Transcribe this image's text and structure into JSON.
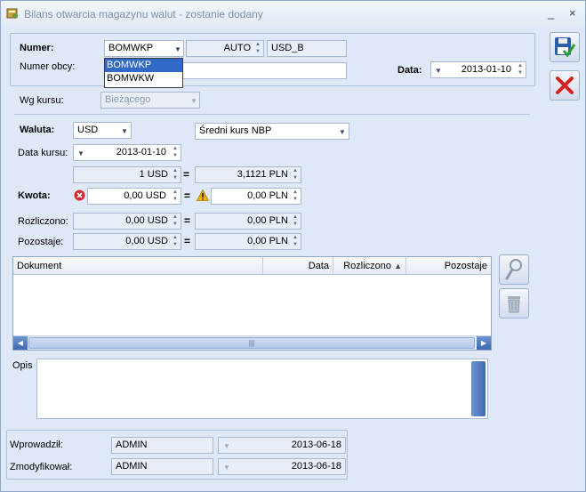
{
  "window": {
    "title": "Bilans otwarcia magazynu walut - zostanie dodany",
    "minimize_glyph": "_",
    "close_glyph": "×"
  },
  "header": {
    "numer_label": "Numer:",
    "numer_value": "BOMWKP",
    "numer_options": [
      "BOMWKP",
      "BOMWKW"
    ],
    "auto_value": "AUTO",
    "series_value": "USD_B",
    "numer_obcy_label": "Numer obcy:",
    "numer_obcy_value": "",
    "data_label": "Data:",
    "data_value": "2013-01-10"
  },
  "rate": {
    "wg_kursu_label": "Wg kursu:",
    "wg_kursu_value": "Bieżącego",
    "waluta_label": "Waluta:",
    "waluta_value": "USD",
    "kurs_type_value": "Średni kurs NBP",
    "data_kursu_label": "Data kursu:",
    "data_kursu_value": "2013-01-10",
    "rate_left": "1 USD",
    "rate_right": "3,1121 PLN"
  },
  "amounts": {
    "kwota_label": "Kwota:",
    "kwota_left": "0,00 USD",
    "kwota_right": "0,00 PLN",
    "rozliczono_label": "Rozliczono:",
    "rozliczono_left": "0,00 USD",
    "rozliczono_right": "0,00 PLN",
    "pozostaje_label": "Pozostaje:",
    "pozostaje_left": "0,00 USD",
    "pozostaje_right": "0,00 PLN",
    "equals": "="
  },
  "grid": {
    "columns": [
      "Dokument",
      "Data",
      "Rozliczono",
      "Pozostaje"
    ],
    "sort_glyph": "▲",
    "rows": []
  },
  "opis": {
    "label": "Opis",
    "value": ""
  },
  "footer": {
    "wprowadzil_label": "Wprowadził:",
    "wprowadzil_user": "ADMIN",
    "wprowadzil_date": "2013-06-18",
    "zmodyfikowal_label": "Zmodyfikował:",
    "zmodyfikowal_user": "ADMIN",
    "zmodyfikowal_date": "2013-06-18"
  },
  "colors": {
    "window_bg": "#dfe8f6",
    "selection": "#3169c6",
    "save_green": "#2e9b3a",
    "close_red": "#d4201f",
    "error_red": "#d42a2a",
    "warning_yellow": "#f2b400"
  }
}
